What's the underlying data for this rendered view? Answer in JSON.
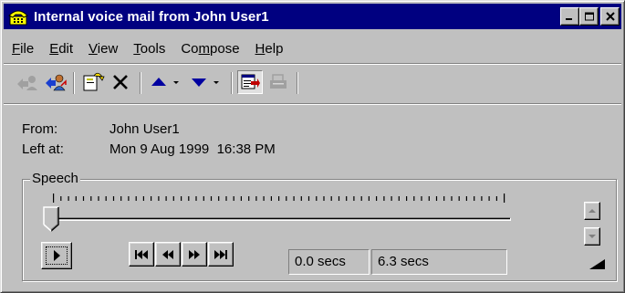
{
  "window": {
    "title": "Internal voice mail from John User1"
  },
  "menu": {
    "items": [
      {
        "label": "File",
        "mnemonic": "F",
        "rest": "ile"
      },
      {
        "label": "Edit",
        "mnemonic": "E",
        "rest": "dit"
      },
      {
        "label": "View",
        "mnemonic": "V",
        "rest": "iew"
      },
      {
        "label": "Tools",
        "mnemonic": "T",
        "rest": "ools"
      },
      {
        "label": "Compose",
        "pre": "Co",
        "mnemonic": "m",
        "rest": "pose"
      },
      {
        "label": "Help",
        "mnemonic": "H",
        "rest": "elp"
      }
    ]
  },
  "toolbar": {
    "icons": [
      "reply-icon",
      "reply-all-icon",
      "forward-icon",
      "delete-icon",
      "previous-message-icon",
      "next-message-icon",
      "properties-icon",
      "print-icon"
    ]
  },
  "message": {
    "from_label": "From:",
    "from_value": "John User1",
    "left_label": "Left at:",
    "left_value": "Mon 9 Aug 1999  16:38 PM"
  },
  "speech": {
    "group_label": "Speech",
    "position_secs": "0.0 secs",
    "length_secs": "6.3 secs",
    "progress_fraction": 0.0
  },
  "colors": {
    "titlebar": "#000080",
    "face": "#c0c0c0",
    "blue_arrow": "#0000a0"
  }
}
